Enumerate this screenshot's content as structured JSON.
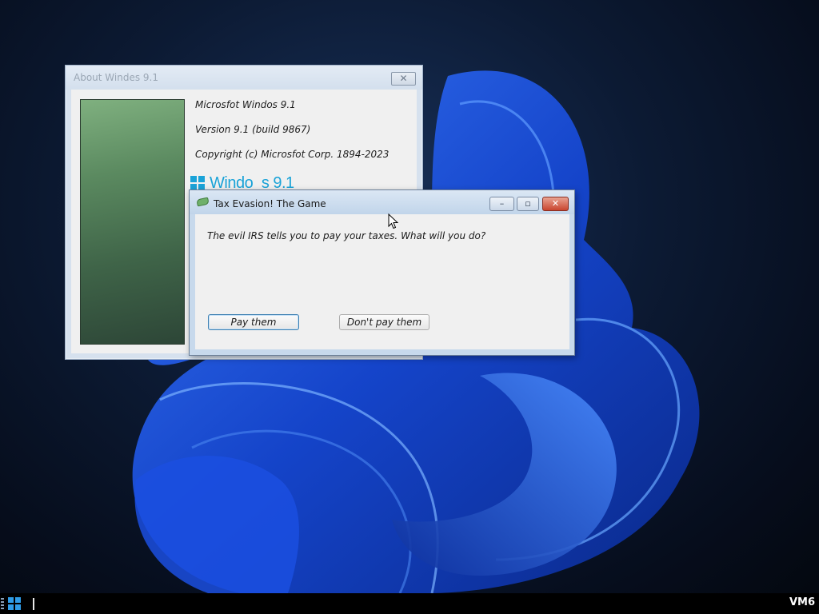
{
  "about_window": {
    "title": "About Windes 9.1",
    "close_label": "✕",
    "product_name": "Microsfot Windos 9.1",
    "version": "Version 9.1 (build 9867)",
    "copyright": "Copyright (c) Microsfot Corp. 1894-2023",
    "logo_text": "Windo_s 9.1"
  },
  "game_window": {
    "title": "Tax Evasion! The Game",
    "minimize_label": "–",
    "maximize_label": "▫",
    "close_label": "✕",
    "prompt": "The evil IRS tells you to pay your taxes. What will you do?",
    "buttons": {
      "pay": "Pay them",
      "dont_pay": "Don't pay them"
    }
  },
  "taskbar": {
    "label": "VM6"
  },
  "colors": {
    "wallpaper_bloom": "#1f4fd8",
    "accent": "#1aa3d8",
    "close_button": "#c9452f"
  },
  "icons": {
    "start": "windows-logo-icon",
    "app": "green-cash-icon",
    "cursor": "mouse-pointer-icon"
  }
}
